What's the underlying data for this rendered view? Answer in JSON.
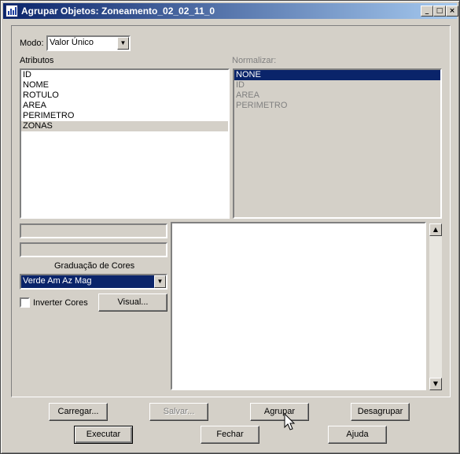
{
  "window": {
    "title": "Agrupar Objetos: Zoneamento_02_02_11_0",
    "minimize_glyph": "_",
    "maximize_glyph": "□",
    "close_glyph": "×"
  },
  "modo": {
    "label": "Modo:",
    "value": "Valor Único"
  },
  "atributos": {
    "label": "Atributos",
    "items": [
      "ID",
      "NOME",
      "ROTULO",
      "AREA",
      "PERIMETRO",
      "ZONAS"
    ],
    "selected": "ZONAS"
  },
  "normalizar": {
    "label": "Normalizar:",
    "items": [
      "NONE",
      "ID",
      "AREA",
      "PERIMETRO"
    ],
    "selected": "NONE"
  },
  "graduacao": {
    "label": "Graduação de Cores",
    "value": "Verde Am Az Mag"
  },
  "inverter": {
    "label": "Inverter Cores",
    "checked": false
  },
  "buttons": {
    "visual": "Visual...",
    "carregar": "Carregar...",
    "salvar": "Salvar...",
    "agrupar": "Agrupar",
    "desagrupar": "Desagrupar",
    "executar": "Executar",
    "fechar": "Fechar",
    "ajuda": "Ajuda"
  },
  "icons": {
    "dropdown_arrow": "▼",
    "scroll_up": "▲",
    "scroll_down": "▼"
  }
}
